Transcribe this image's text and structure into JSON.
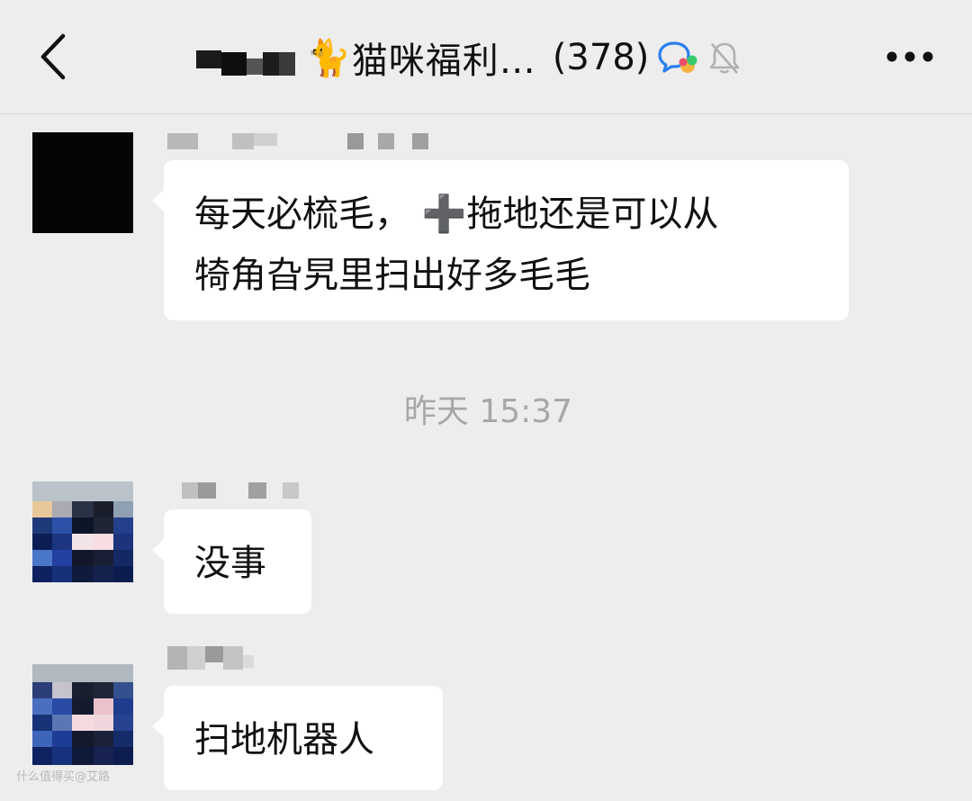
{
  "header": {
    "back_icon": "chevron-left-icon",
    "group_emoji": "🐈",
    "group_name": "猫咪福利…",
    "member_count": "(378)",
    "chat_icon": "group-chat-icon",
    "mute_icon": "bell-off-icon",
    "more_icon": "more-dots-icon"
  },
  "messages": [
    {
      "text": "每天必梳毛， ➕拖地还是可以从",
      "text2": "犄角旮旯里扫出好多毛毛"
    },
    {
      "text": "没事"
    },
    {
      "text": "扫地机器人"
    }
  ],
  "timestamp": "昨天 15:37",
  "watermark": "什么值得买@艾路",
  "colors": {
    "background": "#ededed",
    "bubble": "#ffffff",
    "text": "#111111",
    "timestamp": "#a7a7a7"
  }
}
